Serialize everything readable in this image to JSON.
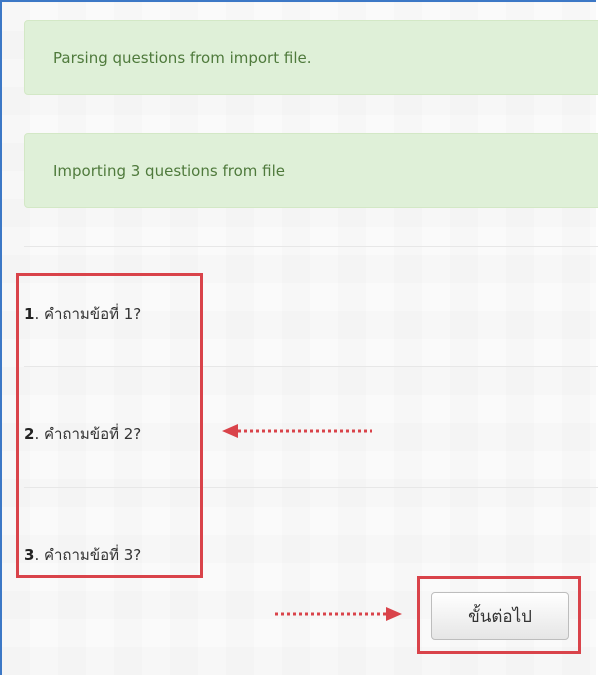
{
  "alerts": {
    "parsing": "Parsing questions from import file.",
    "importing": "Importing 3 questions from file"
  },
  "questions": [
    {
      "number": "1",
      "text": ". คำถามข้อที่ 1?"
    },
    {
      "number": "2",
      "text": ". คำถามข้อที่ 2?"
    },
    {
      "number": "3",
      "text": ". คำถามข้อที่ 3?"
    }
  ],
  "actions": {
    "continue_label": "ขั้นต่อไป"
  },
  "colors": {
    "alert_bg": "#dff0d8",
    "alert_text": "#4f7a3c",
    "annotation_red": "#d9434a"
  }
}
